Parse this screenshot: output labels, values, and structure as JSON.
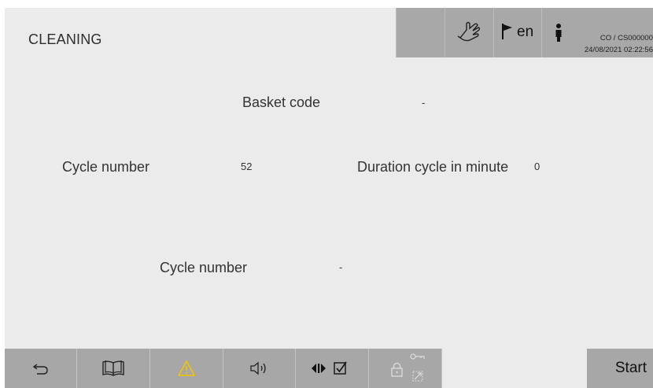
{
  "header": {
    "title": "CLEANING",
    "language": "en",
    "user_line": "CO / CS000000",
    "datetime": "24/08/2021 02:22:56",
    "icons": [
      "hand-icon",
      "flag-icon",
      "person-info-icon"
    ]
  },
  "fields": {
    "basket_code_label": "Basket code",
    "basket_code_value": "-",
    "cycle_number_label": "Cycle number",
    "cycle_number_value": "52",
    "duration_label": "Duration cycle in minute",
    "duration_value": "0",
    "cycle_number2_label": "Cycle number",
    "cycle_number2_value": "-"
  },
  "toolbar": {
    "start_label": "Start",
    "warning_color": "#f5c400",
    "icons": [
      "back-icon",
      "book-icon",
      "warning-icon",
      "speaker-icon",
      "play-check-icon",
      "lock-key-icon"
    ]
  }
}
